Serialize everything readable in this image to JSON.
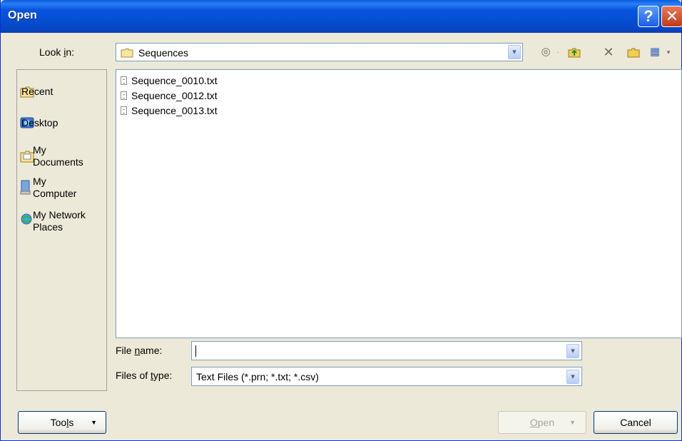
{
  "window": {
    "title": "Open",
    "help_glyph": "?",
    "close_glyph": "✕"
  },
  "look_in": {
    "label_pre": "Look ",
    "label_u": "i",
    "label_post": "n:",
    "value": "Sequences"
  },
  "toolbar": {
    "icons": [
      "back-icon",
      "up-folder-icon",
      "delete-icon",
      "new-folder-icon",
      "views-icon"
    ],
    "back_glyph": "◎",
    "delete_glyph": "✕",
    "views_glyph": "▦"
  },
  "places": [
    {
      "name": "Recent",
      "icon": "recent-folder-icon"
    },
    {
      "name": "Desktop",
      "icon": "desktop-icon"
    },
    {
      "name": "My Documents",
      "line1": "My",
      "line2": "Documents",
      "icon": "my-documents-icon"
    },
    {
      "name": "My Computer",
      "line1": "My",
      "line2": "Computer",
      "icon": "my-computer-icon"
    },
    {
      "name": "My Network Places",
      "line1": "My Network",
      "line2": "Places",
      "icon": "network-places-icon"
    }
  ],
  "files": [
    {
      "name": "Sequence_0010.txt"
    },
    {
      "name": "Sequence_0012.txt"
    },
    {
      "name": "Sequence_0013.txt"
    }
  ],
  "file_name": {
    "label_pre": "File ",
    "label_u": "n",
    "label_post": "ame:",
    "value": ""
  },
  "file_type": {
    "label_pre": "Files of ",
    "label_u": "t",
    "label_post": "ype:",
    "value": "Text Files (*.prn; *.txt; *.csv)"
  },
  "buttons": {
    "tools_pre": "Too",
    "tools_u": "l",
    "tools_post": "s",
    "open_u": "O",
    "open_post": "pen",
    "cancel": "Cancel"
  },
  "colors": {
    "titlebar": "#0451d6",
    "dialog_bg": "#ece9d8",
    "close_red": "#c23a14"
  }
}
